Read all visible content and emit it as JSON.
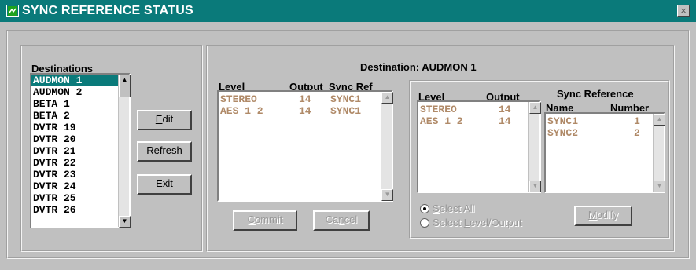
{
  "window": {
    "title": "SYNC REFERENCE STATUS",
    "close_glyph": "×"
  },
  "destinations": {
    "label": "Destinations",
    "items": [
      "AUDMON 1",
      "AUDMON 2",
      "BETA 1",
      "BETA 2",
      "DVTR 19",
      "DVTR 20",
      "DVTR 21",
      "DVTR 22",
      "DVTR 23",
      "DVTR 24",
      "DVTR 25",
      "DVTR 26"
    ],
    "selected_index": 0
  },
  "buttons": {
    "edit": {
      "pre": "",
      "accel": "E",
      "post": "dit"
    },
    "refresh": {
      "pre": "",
      "accel": "R",
      "post": "efresh"
    },
    "exit": {
      "pre": "E",
      "accel": "x",
      "post": "it"
    },
    "commit": {
      "pre": "",
      "accel": "C",
      "post": "ommit"
    },
    "cancel": {
      "pre": "Ca",
      "accel": "n",
      "post": "cel"
    },
    "modify": {
      "pre": "",
      "accel": "M",
      "post": "odify"
    }
  },
  "destination_header": "Destination:  AUDMON 1",
  "current_table": {
    "headers": {
      "level": "Level",
      "output": "Output",
      "sync_ref_pre": "S",
      "sync_ref_accel": "y",
      "sync_ref_post": "nc Ref"
    },
    "rows": [
      {
        "level": "STEREO",
        "output": "14",
        "sync": "SYNC1"
      },
      {
        "level": "AES 1 2",
        "output": "14",
        "sync": "SYNC1"
      }
    ]
  },
  "level_table": {
    "headers": {
      "level": "Level",
      "output": "Output"
    },
    "rows": [
      {
        "level": "STEREO",
        "output": "14"
      },
      {
        "level": "AES 1 2",
        "output": "14"
      }
    ]
  },
  "sync_reference": {
    "title": "Sync Reference",
    "headers": {
      "name": "Name",
      "number": "Number"
    },
    "rows": [
      {
        "name": "SYNC1",
        "number": "1"
      },
      {
        "name": "SYNC2",
        "number": "2"
      }
    ]
  },
  "selection_mode": {
    "select_all": {
      "pre": "",
      "accel": "S",
      "post": "elect All",
      "checked": true
    },
    "select_level_output": {
      "pre": "Select ",
      "accel": "L",
      "post": "evel/Output",
      "checked": false
    }
  },
  "icons": {
    "window": "app-window-icon",
    "scroll_up": "scroll-up-arrow-icon",
    "scroll_down": "scroll-down-arrow-icon"
  }
}
